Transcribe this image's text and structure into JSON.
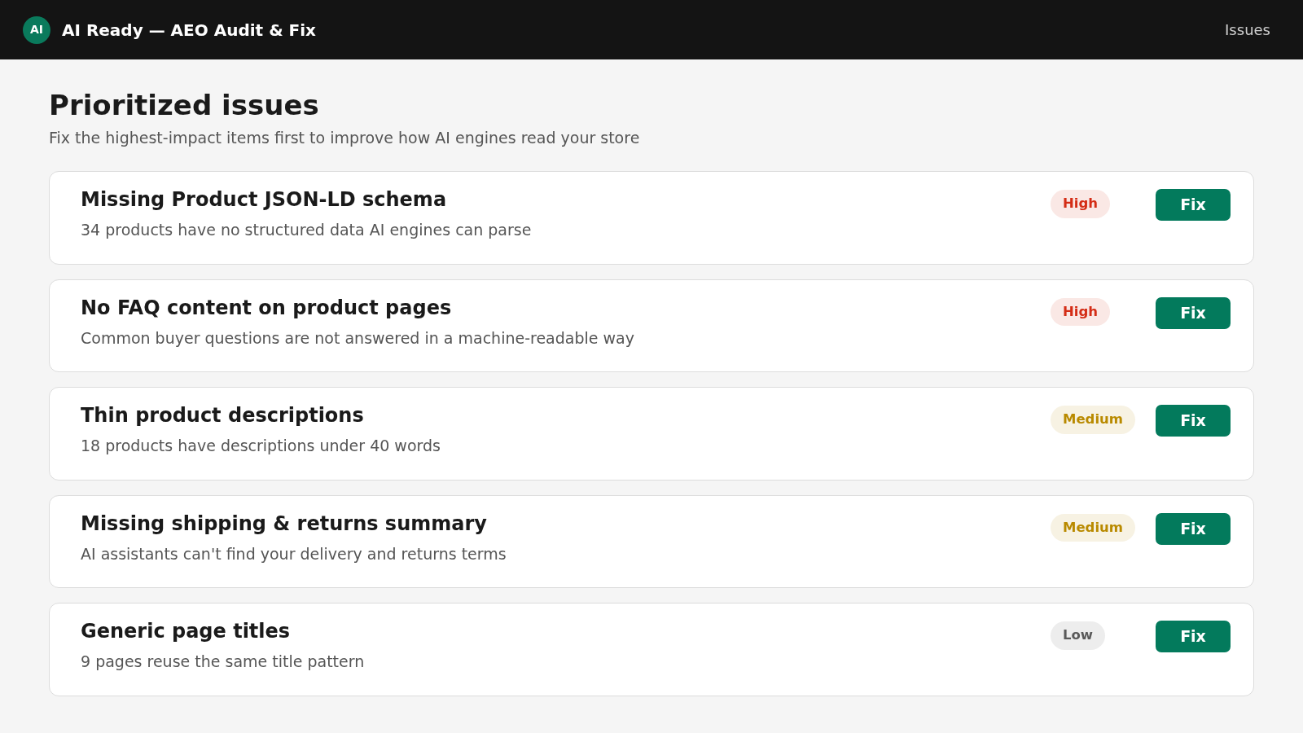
{
  "header": {
    "logo": "AI",
    "title": "AI Ready — AEO Audit & Fix",
    "nav": [
      "Issues"
    ]
  },
  "page": {
    "title": "Prioritized issues",
    "subtitle": "Fix the highest-impact items first to improve how AI engines read your store"
  },
  "issues": [
    {
      "title": "Missing Product JSON-LD schema",
      "description": "34 products have no structured data AI engines can parse",
      "priority": "High",
      "color": "#d42d16",
      "action": "Fix"
    },
    {
      "title": "No FAQ content on product pages",
      "description": "Common buyer questions are not answered in a machine-readable way",
      "priority": "High",
      "color": "#d42d16",
      "action": "Fix"
    },
    {
      "title": "Thin product descriptions",
      "description": "18 products have descriptions under 40 words",
      "priority": "Medium",
      "color": "#b98a00",
      "action": "Fix"
    },
    {
      "title": "Missing shipping & returns summary",
      "description": "AI assistants can't find your delivery and returns terms",
      "priority": "Medium",
      "color": "#b98a00",
      "action": "Fix"
    },
    {
      "title": "Generic page titles",
      "description": "9 pages reuse the same title pattern",
      "priority": "Low",
      "color": "#5a5a5a",
      "action": "Fix"
    }
  ]
}
